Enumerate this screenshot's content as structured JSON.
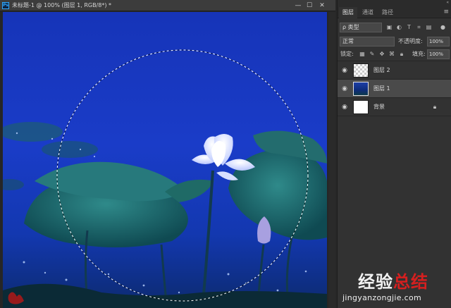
{
  "document": {
    "title": "未标题-1 @ 100% (图层 1, RGB/8*) *",
    "app_icon": "Ps",
    "min_icon": "—",
    "max_icon": "☐",
    "close_icon": "✕"
  },
  "panel": {
    "collapse_icon": "«",
    "tabs": [
      {
        "label": "图层",
        "active": true
      },
      {
        "label": "通道",
        "active": false
      },
      {
        "label": "路径",
        "active": false
      }
    ],
    "menu_icon": "≡",
    "filter": {
      "label": "ρ 类型"
    },
    "blend_mode": {
      "value": "正常"
    },
    "opacity": {
      "label": "不透明度:",
      "value": "100%"
    },
    "lock": {
      "label": "锁定:"
    },
    "fill": {
      "label": "填充:",
      "value": "100%"
    },
    "layers": [
      {
        "name": "图层 2",
        "thumb": "transparent",
        "selected": false,
        "locked": false
      },
      {
        "name": "图层 1",
        "thumb": "photo",
        "selected": true,
        "locked": false
      },
      {
        "name": "背景",
        "thumb": "white",
        "selected": false,
        "locked": true
      }
    ]
  },
  "watermark": {
    "title_part1": "经验",
    "title_part2": "总结",
    "url": "jingyanzongjie.com"
  },
  "colors": {
    "accent": "#31a8ff",
    "panel_bg": "#323232",
    "selected_layer": "#4a4a4a",
    "watermark_red": "#d61f1f"
  }
}
